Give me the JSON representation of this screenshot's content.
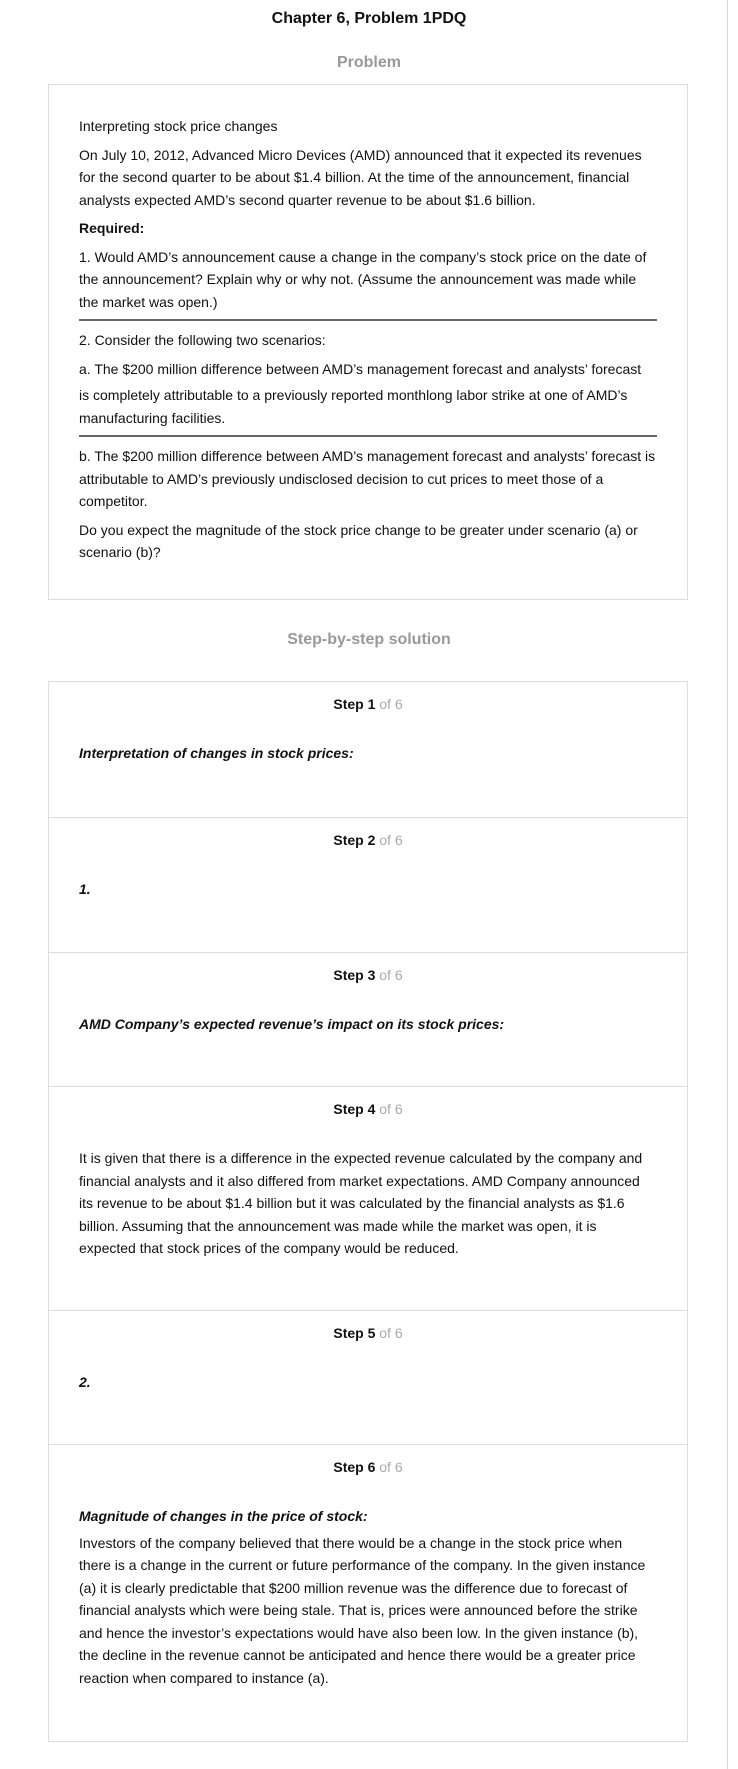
{
  "title": "Chapter 6, Problem 1PDQ",
  "problem_heading": "Problem",
  "problem": {
    "topic": "Interpreting stock price changes",
    "intro": "On July 10, 2012, Advanced Micro Devices (AMD) announced that it expected its revenues for the second quarter to be about $1.4 billion. At the time of the announcement, financial analysts expected AMD’s second quarter revenue to be about $1.6 billion.",
    "required_label": "Required:",
    "q1": "1. Would AMD’s announcement cause a change in the company’s stock price on the date of the announcement? Explain why or why not. (Assume the announcement was made while the market was open.)",
    "q2": "2. Consider the following two scenarios:",
    "q2a_1": "a. The $200 million difference between AMD’s management forecast and analysts’ forecast",
    "q2a_2": "is completely attributable to a previously reported monthlong labor strike at one of AMD’s manufacturing facilities.",
    "q2b": "b. The $200 million difference between AMD’s management forecast and analysts’ forecast is attributable to AMD’s previously undisclosed decision to cut prices to meet those of a competitor.",
    "q2c": "Do you expect the magnitude of the stock price change to be greater under scenario (a) or scenario (b)?"
  },
  "solution_heading": "Step-by-step solution",
  "steps": [
    {
      "label": "Step 1",
      "of": "of 6",
      "heading": "Interpretation of changes in stock prices:",
      "text": ""
    },
    {
      "label": "Step 2",
      "of": "of 6",
      "heading": "1.",
      "text": ""
    },
    {
      "label": "Step 3",
      "of": "of 6",
      "heading": "AMD Company’s expected revenue’s impact on its stock prices:",
      "text": ""
    },
    {
      "label": "Step 4",
      "of": "of 6",
      "heading": "",
      "text": "It is given that there is a difference in the expected revenue calculated by the company and financial analysts and it also differed from market expectations. AMD Company announced its revenue to be about $1.4 billion but it was calculated by the financial analysts as $1.6 billion. Assuming that the announcement was made while the market was open, it is expected that stock prices of the company would be reduced."
    },
    {
      "label": "Step 5",
      "of": "of 6",
      "heading": "2.",
      "text": ""
    },
    {
      "label": "Step 6",
      "of": "of 6",
      "heading": "Magnitude of changes in the price of stock:",
      "text": "Investors of the company believed that there would be a change in the stock price when there is a change in the current or future performance of the company. In the given instance (a) it is clearly predictable that $200 million revenue was the difference due to forecast of financial analysts which were being stale. That is, prices were announced before the strike and hence the investor’s expectations would have also been low. In the given instance (b), the decline in the revenue cannot be anticipated and hence there would be a greater price reaction when compared to instance (a)."
    }
  ]
}
